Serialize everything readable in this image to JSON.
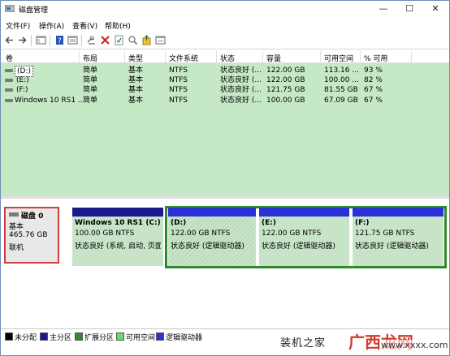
{
  "window": {
    "title": "磁盘管理",
    "controls": {
      "minimize": "—",
      "maximize": "☐",
      "close": "✕"
    }
  },
  "menu": [
    {
      "label": "文件(F)"
    },
    {
      "label": "操作(A)"
    },
    {
      "label": "查看(V)"
    },
    {
      "label": "帮助(H)"
    }
  ],
  "toolbar": [
    "back-icon",
    "forward-icon",
    "console-icon",
    "help-icon",
    "properties-icon",
    "connect-icon",
    "delete-icon",
    "check-icon",
    "search-icon",
    "export-icon",
    "view-icon"
  ],
  "columns": [
    "卷",
    "布局",
    "类型",
    "文件系统",
    "状态",
    "容量",
    "可用空间",
    "% 可用"
  ],
  "volumes": [
    {
      "name": "(D:)",
      "layout": "简单",
      "type": "基本",
      "fs": "NTFS",
      "status": "状态良好 (...",
      "capacity": "122.00 GB",
      "free": "113.16 ...",
      "pct": "93 %"
    },
    {
      "name": "(E:)",
      "layout": "简单",
      "type": "基本",
      "fs": "NTFS",
      "status": "状态良好 (...",
      "capacity": "122.00 GB",
      "free": "100.00 ...",
      "pct": "82 %"
    },
    {
      "name": "(F:)",
      "layout": "简单",
      "type": "基本",
      "fs": "NTFS",
      "status": "状态良好 (...",
      "capacity": "121.75 GB",
      "free": "81.55 GB",
      "pct": "67 %"
    },
    {
      "name": "Windows 10 RS1 ...",
      "layout": "简单",
      "type": "基本",
      "fs": "NTFS",
      "status": "状态良好 (...",
      "capacity": "100.00 GB",
      "free": "67.09 GB",
      "pct": "67 %"
    }
  ],
  "disk": {
    "name": "磁盘 0",
    "type": "基本",
    "size": "465.76 GB",
    "state": "联机"
  },
  "partitions": [
    {
      "title": "Windows 10 RS1  (C:)",
      "size": "100.00 GB NTFS",
      "status": "状态良好 (系统, 启动, 页面"
    },
    {
      "title": "(D:)",
      "size": "122.00 GB NTFS",
      "status": "状态良好 (逻辑驱动器)"
    },
    {
      "title": "(E:)",
      "size": "122.00 GB NTFS",
      "status": "状态良好 (逻辑驱动器)"
    },
    {
      "title": "(F:)",
      "size": "121.75 GB NTFS",
      "status": "状态良好 (逻辑驱动器)"
    }
  ],
  "legend": [
    {
      "label": "未分配",
      "color": "#000000"
    },
    {
      "label": "主分区",
      "color": "#1a1a8c"
    },
    {
      "label": "扩展分区",
      "color": "#2f8a2f"
    },
    {
      "label": "可用空间",
      "color": "#66dd66"
    },
    {
      "label": "逻辑驱动器",
      "color": "#2a32d6"
    }
  ],
  "colors": {
    "primary_bar": "#1a1a8c",
    "logical_bar": "#2a32d6",
    "extended_frame": "#2f8a2f",
    "list_bg": "#c5e8c5"
  },
  "watermark": {
    "text1": "装机之家",
    "text2": "广西龙网",
    "text3": "www.xxxx.com"
  }
}
